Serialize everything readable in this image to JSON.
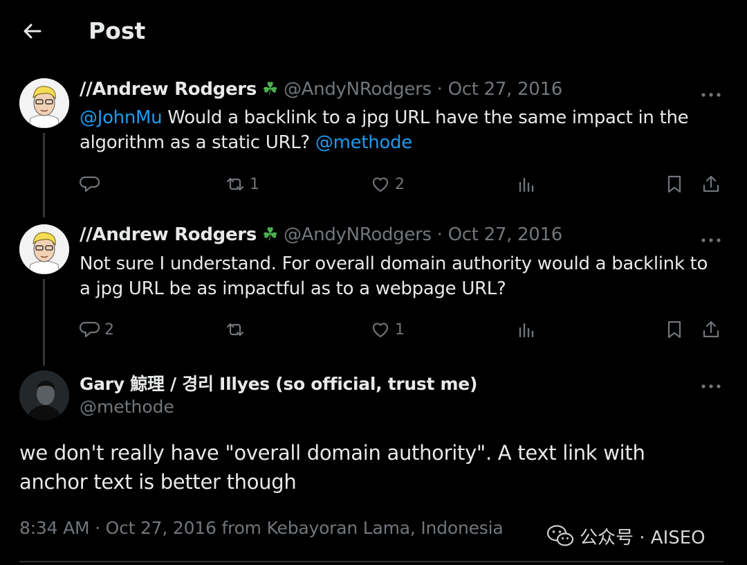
{
  "header": {
    "title": "Post"
  },
  "tweets": [
    {
      "name": "//Andrew Rodgers",
      "emoji": "☘",
      "handle": "@AndyNRodgers",
      "date": "Oct 27, 2016",
      "mention1": "@JohnMu",
      "text": " Would a backlink to a jpg URL have the same impact in the algorithm as a static URL? ",
      "mention2": "@methode",
      "replies": "",
      "retweets": "1",
      "likes": "2"
    },
    {
      "name": "//Andrew Rodgers",
      "emoji": "☘",
      "handle": "@AndyNRodgers",
      "date": "Oct 27, 2016",
      "text": "Not sure I understand. For overall domain authority would a backlink to a jpg URL be as impactful as to a webpage URL?",
      "replies": "2",
      "retweets": "",
      "likes": "1"
    }
  ],
  "main": {
    "name": "Gary 鯨理 / 경리 Illyes (so official, trust me)",
    "handle": "@methode",
    "text": "we don't really have \"overall domain authority\". A text link with anchor text is better though",
    "timestamp": "8:34 AM · Oct 27, 2016 from Kebayoran Lama, Indonesia"
  },
  "watermark": {
    "text": "公众号 · AISEO",
    "icon": "wechat-icon"
  },
  "colors": {
    "background": "#000000",
    "text": "#e7e9ea",
    "muted": "#71767b",
    "link": "#1d9bf0",
    "divider": "#2f3336"
  }
}
